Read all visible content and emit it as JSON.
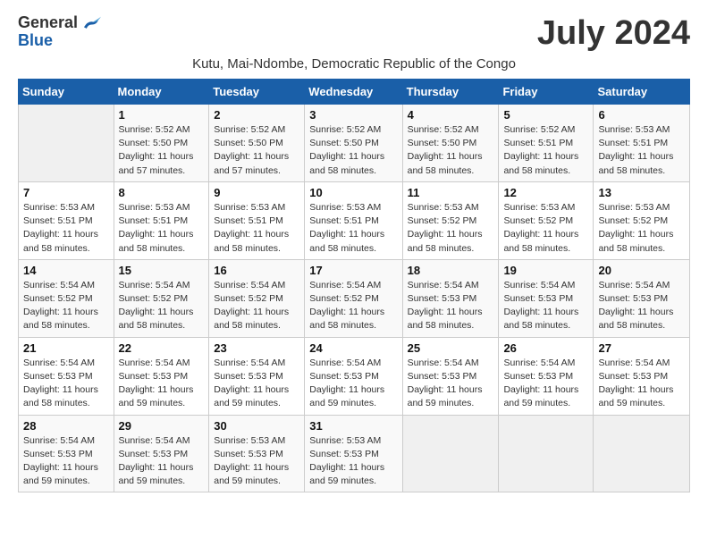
{
  "header": {
    "logo_general": "General",
    "logo_blue": "Blue",
    "month_title": "July 2024",
    "subtitle": "Kutu, Mai-Ndombe, Democratic Republic of the Congo"
  },
  "days_of_week": [
    "Sunday",
    "Monday",
    "Tuesday",
    "Wednesday",
    "Thursday",
    "Friday",
    "Saturday"
  ],
  "weeks": [
    [
      {
        "day": "",
        "info": ""
      },
      {
        "day": "1",
        "info": "Sunrise: 5:52 AM\nSunset: 5:50 PM\nDaylight: 11 hours\nand 57 minutes."
      },
      {
        "day": "2",
        "info": "Sunrise: 5:52 AM\nSunset: 5:50 PM\nDaylight: 11 hours\nand 57 minutes."
      },
      {
        "day": "3",
        "info": "Sunrise: 5:52 AM\nSunset: 5:50 PM\nDaylight: 11 hours\nand 58 minutes."
      },
      {
        "day": "4",
        "info": "Sunrise: 5:52 AM\nSunset: 5:50 PM\nDaylight: 11 hours\nand 58 minutes."
      },
      {
        "day": "5",
        "info": "Sunrise: 5:52 AM\nSunset: 5:51 PM\nDaylight: 11 hours\nand 58 minutes."
      },
      {
        "day": "6",
        "info": "Sunrise: 5:53 AM\nSunset: 5:51 PM\nDaylight: 11 hours\nand 58 minutes."
      }
    ],
    [
      {
        "day": "7",
        "info": "Sunrise: 5:53 AM\nSunset: 5:51 PM\nDaylight: 11 hours\nand 58 minutes."
      },
      {
        "day": "8",
        "info": "Sunrise: 5:53 AM\nSunset: 5:51 PM\nDaylight: 11 hours\nand 58 minutes."
      },
      {
        "day": "9",
        "info": "Sunrise: 5:53 AM\nSunset: 5:51 PM\nDaylight: 11 hours\nand 58 minutes."
      },
      {
        "day": "10",
        "info": "Sunrise: 5:53 AM\nSunset: 5:51 PM\nDaylight: 11 hours\nand 58 minutes."
      },
      {
        "day": "11",
        "info": "Sunrise: 5:53 AM\nSunset: 5:52 PM\nDaylight: 11 hours\nand 58 minutes."
      },
      {
        "day": "12",
        "info": "Sunrise: 5:53 AM\nSunset: 5:52 PM\nDaylight: 11 hours\nand 58 minutes."
      },
      {
        "day": "13",
        "info": "Sunrise: 5:53 AM\nSunset: 5:52 PM\nDaylight: 11 hours\nand 58 minutes."
      }
    ],
    [
      {
        "day": "14",
        "info": "Sunrise: 5:54 AM\nSunset: 5:52 PM\nDaylight: 11 hours\nand 58 minutes."
      },
      {
        "day": "15",
        "info": "Sunrise: 5:54 AM\nSunset: 5:52 PM\nDaylight: 11 hours\nand 58 minutes."
      },
      {
        "day": "16",
        "info": "Sunrise: 5:54 AM\nSunset: 5:52 PM\nDaylight: 11 hours\nand 58 minutes."
      },
      {
        "day": "17",
        "info": "Sunrise: 5:54 AM\nSunset: 5:52 PM\nDaylight: 11 hours\nand 58 minutes."
      },
      {
        "day": "18",
        "info": "Sunrise: 5:54 AM\nSunset: 5:53 PM\nDaylight: 11 hours\nand 58 minutes."
      },
      {
        "day": "19",
        "info": "Sunrise: 5:54 AM\nSunset: 5:53 PM\nDaylight: 11 hours\nand 58 minutes."
      },
      {
        "day": "20",
        "info": "Sunrise: 5:54 AM\nSunset: 5:53 PM\nDaylight: 11 hours\nand 58 minutes."
      }
    ],
    [
      {
        "day": "21",
        "info": "Sunrise: 5:54 AM\nSunset: 5:53 PM\nDaylight: 11 hours\nand 58 minutes."
      },
      {
        "day": "22",
        "info": "Sunrise: 5:54 AM\nSunset: 5:53 PM\nDaylight: 11 hours\nand 59 minutes."
      },
      {
        "day": "23",
        "info": "Sunrise: 5:54 AM\nSunset: 5:53 PM\nDaylight: 11 hours\nand 59 minutes."
      },
      {
        "day": "24",
        "info": "Sunrise: 5:54 AM\nSunset: 5:53 PM\nDaylight: 11 hours\nand 59 minutes."
      },
      {
        "day": "25",
        "info": "Sunrise: 5:54 AM\nSunset: 5:53 PM\nDaylight: 11 hours\nand 59 minutes."
      },
      {
        "day": "26",
        "info": "Sunrise: 5:54 AM\nSunset: 5:53 PM\nDaylight: 11 hours\nand 59 minutes."
      },
      {
        "day": "27",
        "info": "Sunrise: 5:54 AM\nSunset: 5:53 PM\nDaylight: 11 hours\nand 59 minutes."
      }
    ],
    [
      {
        "day": "28",
        "info": "Sunrise: 5:54 AM\nSunset: 5:53 PM\nDaylight: 11 hours\nand 59 minutes."
      },
      {
        "day": "29",
        "info": "Sunrise: 5:54 AM\nSunset: 5:53 PM\nDaylight: 11 hours\nand 59 minutes."
      },
      {
        "day": "30",
        "info": "Sunrise: 5:53 AM\nSunset: 5:53 PM\nDaylight: 11 hours\nand 59 minutes."
      },
      {
        "day": "31",
        "info": "Sunrise: 5:53 AM\nSunset: 5:53 PM\nDaylight: 11 hours\nand 59 minutes."
      },
      {
        "day": "",
        "info": ""
      },
      {
        "day": "",
        "info": ""
      },
      {
        "day": "",
        "info": ""
      }
    ]
  ]
}
